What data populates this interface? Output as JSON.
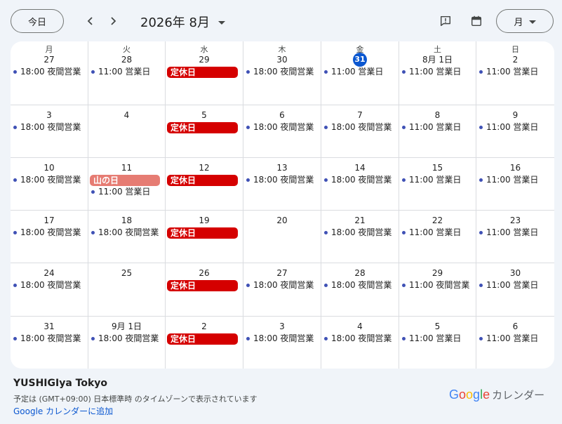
{
  "header": {
    "today_label": "今日",
    "month_title": "2026年 8月",
    "view_label": "月",
    "prev_icon": "chevron-left-icon",
    "next_icon": "chevron-right-icon",
    "feedback_icon": "feedback-icon",
    "calendar_icon": "calendar-icon"
  },
  "weekdays": [
    "月",
    "火",
    "水",
    "木",
    "金",
    "土",
    "日"
  ],
  "weeks": [
    [
      {
        "date": "27",
        "events": [
          {
            "type": "dot",
            "text": "18:00 夜間営業"
          }
        ]
      },
      {
        "date": "28",
        "events": [
          {
            "type": "dot",
            "text": "11:00 営業日"
          }
        ]
      },
      {
        "date": "29",
        "events": [
          {
            "type": "chip",
            "text": "定休日"
          }
        ]
      },
      {
        "date": "30",
        "events": [
          {
            "type": "dot",
            "text": "18:00 夜間営業"
          }
        ]
      },
      {
        "date": "31",
        "today": true,
        "events": [
          {
            "type": "dot",
            "text": "11:00 営業日"
          }
        ]
      },
      {
        "date": "8月 1日",
        "events": [
          {
            "type": "dot",
            "text": "11:00 営業日"
          }
        ]
      },
      {
        "date": "2",
        "events": [
          {
            "type": "dot",
            "text": "11:00 営業日"
          }
        ]
      }
    ],
    [
      {
        "date": "3",
        "events": [
          {
            "type": "dot",
            "text": "18:00 夜間営業"
          }
        ]
      },
      {
        "date": "4",
        "events": []
      },
      {
        "date": "5",
        "events": [
          {
            "type": "chip",
            "text": "定休日"
          }
        ]
      },
      {
        "date": "6",
        "events": [
          {
            "type": "dot",
            "text": "18:00 夜間営業"
          }
        ]
      },
      {
        "date": "7",
        "events": [
          {
            "type": "dot",
            "text": "18:00 夜間営業"
          }
        ]
      },
      {
        "date": "8",
        "events": [
          {
            "type": "dot",
            "text": "11:00 営業日"
          }
        ]
      },
      {
        "date": "9",
        "events": [
          {
            "type": "dot",
            "text": "11:00 営業日"
          }
        ]
      }
    ],
    [
      {
        "date": "10",
        "events": [
          {
            "type": "dot",
            "text": "18:00 夜間営業"
          }
        ]
      },
      {
        "date": "11",
        "events": [
          {
            "type": "holiday",
            "text": "山の日"
          },
          {
            "type": "dot",
            "text": "11:00 営業日"
          }
        ]
      },
      {
        "date": "12",
        "events": [
          {
            "type": "chip",
            "text": "定休日"
          }
        ]
      },
      {
        "date": "13",
        "events": [
          {
            "type": "dot",
            "text": "18:00 夜間営業"
          }
        ]
      },
      {
        "date": "14",
        "events": [
          {
            "type": "dot",
            "text": "18:00 夜間営業"
          }
        ]
      },
      {
        "date": "15",
        "events": [
          {
            "type": "dot",
            "text": "11:00 営業日"
          }
        ]
      },
      {
        "date": "16",
        "events": [
          {
            "type": "dot",
            "text": "11:00 営業日"
          }
        ]
      }
    ],
    [
      {
        "date": "17",
        "events": [
          {
            "type": "dot",
            "text": "18:00 夜間営業"
          }
        ]
      },
      {
        "date": "18",
        "events": [
          {
            "type": "dot",
            "text": "18:00 夜間営業"
          }
        ]
      },
      {
        "date": "19",
        "events": [
          {
            "type": "chip",
            "text": "定休日"
          }
        ]
      },
      {
        "date": "20",
        "events": []
      },
      {
        "date": "21",
        "events": [
          {
            "type": "dot",
            "text": "18:00 夜間営業"
          }
        ]
      },
      {
        "date": "22",
        "events": [
          {
            "type": "dot",
            "text": "11:00 営業日"
          }
        ]
      },
      {
        "date": "23",
        "events": [
          {
            "type": "dot",
            "text": "11:00 営業日"
          }
        ]
      }
    ],
    [
      {
        "date": "24",
        "events": [
          {
            "type": "dot",
            "text": "18:00 夜間営業"
          }
        ]
      },
      {
        "date": "25",
        "events": []
      },
      {
        "date": "26",
        "events": [
          {
            "type": "chip",
            "text": "定休日"
          }
        ]
      },
      {
        "date": "27",
        "events": [
          {
            "type": "dot",
            "text": "18:00 夜間営業"
          }
        ]
      },
      {
        "date": "28",
        "events": [
          {
            "type": "dot",
            "text": "18:00 夜間営業"
          }
        ]
      },
      {
        "date": "29",
        "events": [
          {
            "type": "dot",
            "text": "11:00 夜間営業"
          }
        ]
      },
      {
        "date": "30",
        "events": [
          {
            "type": "dot",
            "text": "11:00 営業日"
          }
        ]
      }
    ],
    [
      {
        "date": "31",
        "events": [
          {
            "type": "dot",
            "text": "18:00 夜間営業"
          }
        ]
      },
      {
        "date": "9月 1日",
        "events": [
          {
            "type": "dot",
            "text": "18:00 夜間営業"
          }
        ]
      },
      {
        "date": "2",
        "events": [
          {
            "type": "chip",
            "text": "定休日"
          }
        ]
      },
      {
        "date": "3",
        "events": [
          {
            "type": "dot",
            "text": "18:00 夜間営業"
          }
        ]
      },
      {
        "date": "4",
        "events": [
          {
            "type": "dot",
            "text": "18:00 夜間営業"
          }
        ]
      },
      {
        "date": "5",
        "events": [
          {
            "type": "dot",
            "text": "11:00 営業日"
          }
        ]
      },
      {
        "date": "6",
        "events": [
          {
            "type": "dot",
            "text": "11:00 営業日"
          }
        ]
      }
    ]
  ],
  "footer": {
    "calendar_name": "YUSHIGIya Tokyo",
    "timezone_note": "予定は (GMT+09:00) 日本標準時 のタイムゾーンで表示されています",
    "add_link": "Google カレンダーに追加",
    "brand_google": "Google",
    "brand_calendar": "カレンダー"
  },
  "colors": {
    "accent": "#0b57d0",
    "closed_chip": "#d50000",
    "holiday_chip": "#e67c73",
    "event_dot": "#3f51b5",
    "background": "#f0f4f9"
  }
}
